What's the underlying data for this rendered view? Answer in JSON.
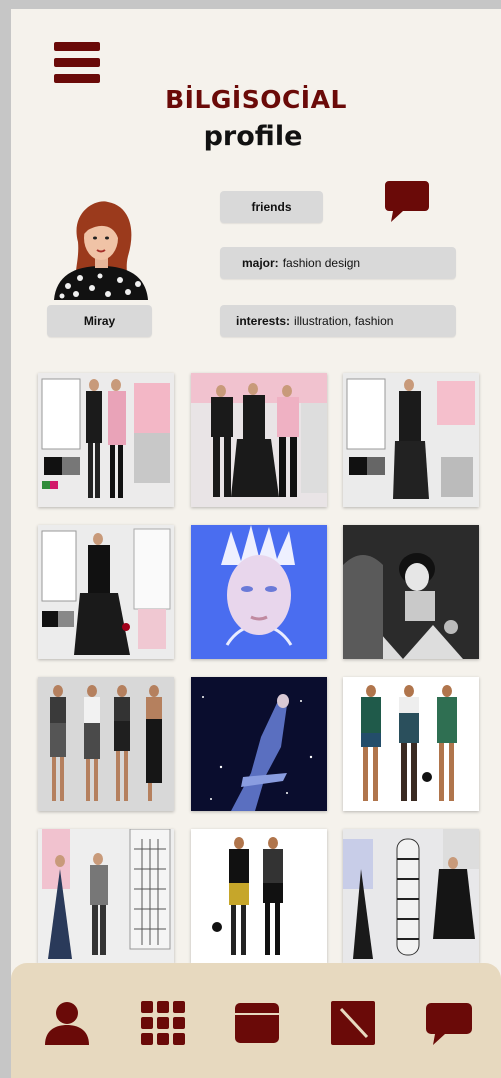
{
  "app": {
    "brand": "BİLGİSOCİAL",
    "page_title": "profile"
  },
  "profile": {
    "name": "Miray",
    "friends_label": "friends",
    "major_label": "major:",
    "major_value": "fashion design",
    "interests_label": "interests:",
    "interests_value": "illustration, fashion"
  },
  "icons": {
    "menu": "hamburger-menu-icon",
    "chat": "chat-bubble-icon",
    "profile": "person-icon",
    "grid": "grid-icon",
    "calendar": "calendar-icon",
    "edit": "edit-icon",
    "messages": "chat-bubble-icon"
  },
  "colors": {
    "accent": "#6a0a08",
    "background": "#f5f2ec",
    "pill": "#d9d9d9",
    "nav_bar": "#e7d9bf"
  },
  "gallery": [
    {
      "id": "post-1",
      "subject": "fashion collage"
    },
    {
      "id": "post-2",
      "subject": "fashion collage"
    },
    {
      "id": "post-3",
      "subject": "fashion collage"
    },
    {
      "id": "post-4",
      "subject": "fashion collage"
    },
    {
      "id": "post-5",
      "subject": "blue face illustration"
    },
    {
      "id": "post-6",
      "subject": "monochrome woman illustration"
    },
    {
      "id": "post-7",
      "subject": "fashion lineup"
    },
    {
      "id": "post-8",
      "subject": "night singer illustration"
    },
    {
      "id": "post-9",
      "subject": "plaid outfits"
    },
    {
      "id": "post-10",
      "subject": "couture collage"
    },
    {
      "id": "post-11",
      "subject": "plaid outfits"
    },
    {
      "id": "post-12",
      "subject": "couture collage"
    }
  ]
}
